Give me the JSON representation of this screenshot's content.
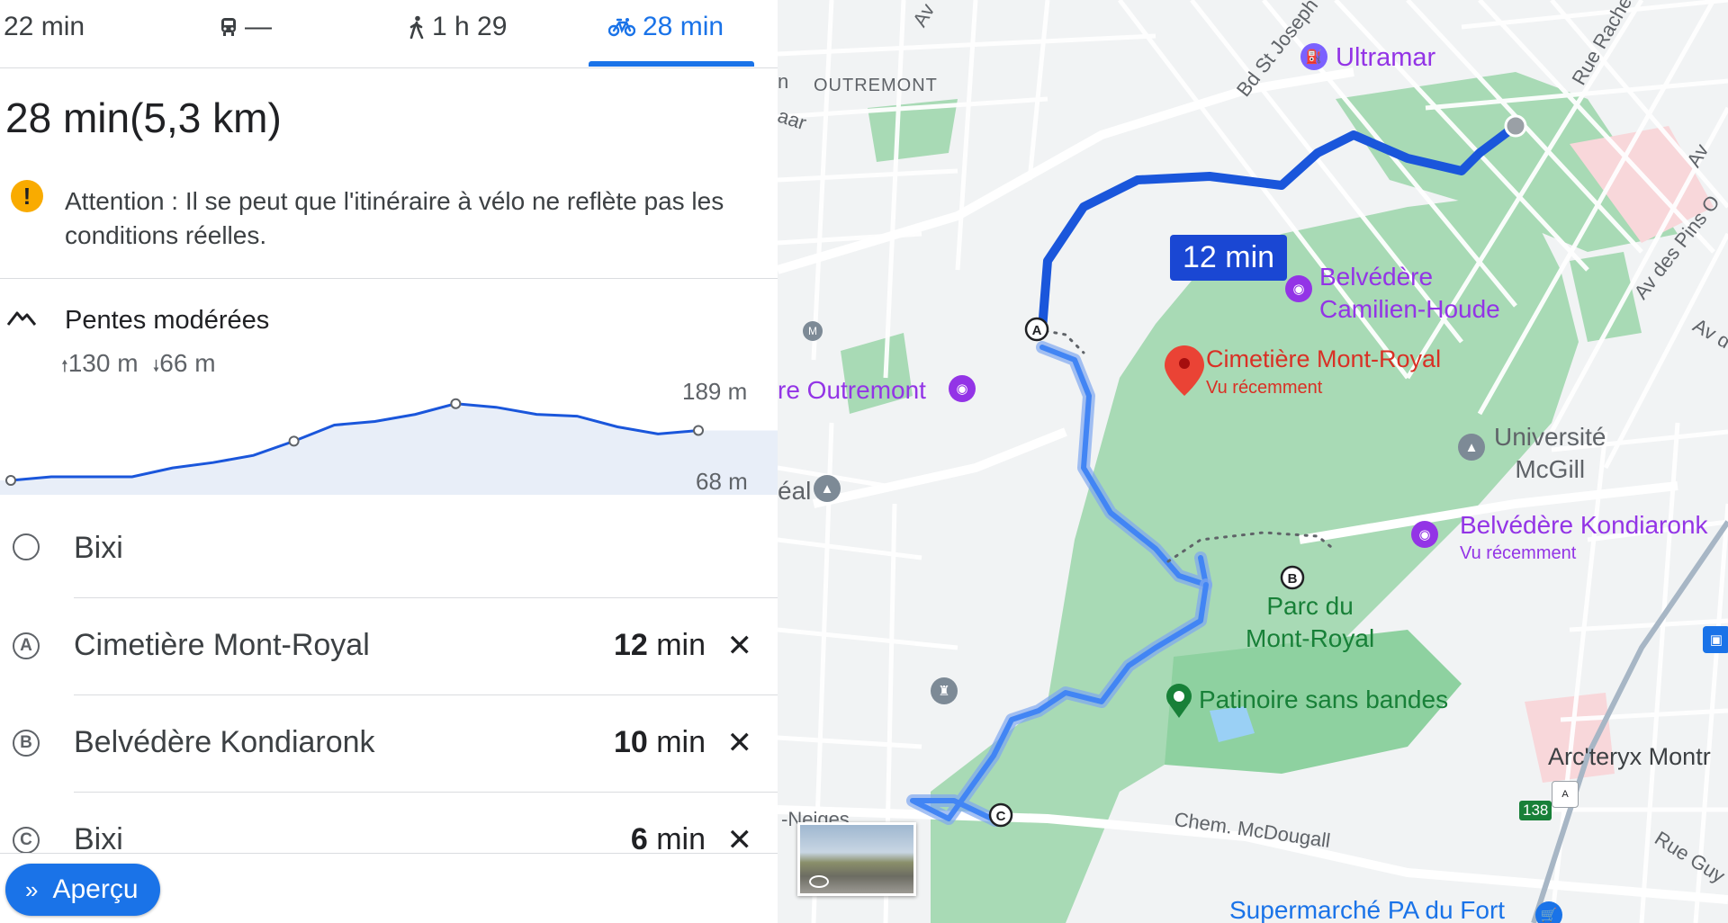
{
  "tabs": [
    {
      "label": "22 min",
      "icon": "car-icon"
    },
    {
      "label": "—",
      "icon": "transit-icon"
    },
    {
      "label": "1 h 29",
      "icon": "walk-icon"
    },
    {
      "label": "28 min",
      "icon": "bike-icon",
      "active": true
    }
  ],
  "summary": {
    "duration": "28 min",
    "distance": "(5,3 km)"
  },
  "warning": {
    "text": "Attention : Il se peut que l'itinéraire à vélo ne reflète pas les conditions réelles."
  },
  "slope": {
    "title": "Pentes modérées",
    "ascent": "130 m",
    "descent": "66 m",
    "max_label": "189 m",
    "min_label": "68 m"
  },
  "elevation_profile": [
    68,
    72,
    72,
    72,
    82,
    88,
    96,
    112,
    130,
    134,
    142,
    154,
    150,
    142,
    140,
    128,
    120,
    124
  ],
  "stops": [
    {
      "marker": "",
      "name": "Bixi",
      "duration": "",
      "unit": ""
    },
    {
      "marker": "A",
      "name": "Cimetière Mont-Royal",
      "duration": "12",
      "unit": " min"
    },
    {
      "marker": "B",
      "name": "Belvédère Kondiaronk",
      "duration": "10",
      "unit": " min"
    },
    {
      "marker": "C",
      "name": "Bixi",
      "duration": "6",
      "unit": " min"
    }
  ],
  "remove_glyph": "✕",
  "preview_button": {
    "label": "Aperçu",
    "chevron": "»"
  },
  "map": {
    "route_badge": "12 min",
    "labels": {
      "outremont": "OUTREMONT",
      "ultramar": "Ultramar",
      "bd_st_joseph": "Bd St Joseph",
      "rue_rachel": "Rue Rachel",
      "av_des_pins": "Av des Pins O",
      "av_partial": "Av",
      "av_partial2": "Av d",
      "av_top": "Av",
      "belvedere_ch_1": "Belvédère",
      "belvedere_ch_2": "Camilien-Houde",
      "cimetiere": "Cimetière Mont-Royal",
      "cimetiere_sub": "Vu récemment",
      "outremont_park": "re Outremont",
      "real": "éal",
      "mcgill_1": "Université",
      "mcgill_2": "McGill",
      "kondiaronk": "Belvédère Kondiaronk",
      "kondiaronk_sub": "Vu récemment",
      "parc_1": "Parc du",
      "parc_2": "Mont-Royal",
      "patinoire": "Patinoire sans bandes",
      "arcteryx": "Arc'teryx Montr",
      "route_138": "138",
      "chem_mcdougall": "Chem. McDougall",
      "rue_guy": "Rue Guy",
      "neiges": "-Neiges",
      "supermarche": "Supermarché PA du Fort",
      "aar": "aar",
      "an": "n",
      "metro_m": "M"
    },
    "colors": {
      "route": "#1a56db",
      "park": "#a8dab5",
      "park_dark": "#8ed1a0",
      "road": "#ffffff",
      "poi": "#9334e6"
    }
  }
}
